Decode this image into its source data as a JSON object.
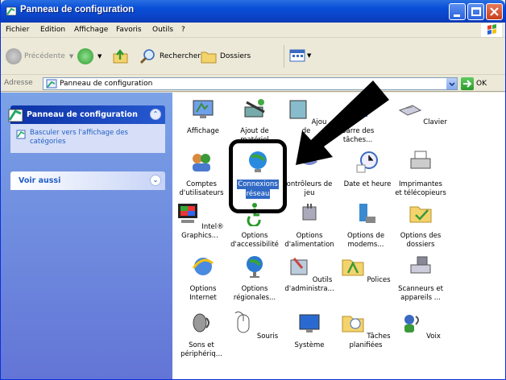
{
  "window": {
    "title": "Panneau de configuration"
  },
  "menu": [
    "Fichier",
    "Edition",
    "Affichage",
    "Favoris",
    "Outils",
    "?"
  ],
  "toolbar": {
    "back": "Précédente",
    "search": "Rechercher",
    "folders": "Dossiers"
  },
  "address": {
    "label": "Adresse",
    "value": "Panneau de configuration",
    "go": "OK"
  },
  "sidebar": {
    "panel1": {
      "title": "Panneau de configuration",
      "link": "Basculer vers l'affichage des catégories"
    },
    "panel2": {
      "title": "Voir aussi"
    }
  },
  "items": [
    {
      "l1": "Affichage",
      "l2": ""
    },
    {
      "l1": "Ajout de",
      "l2": "matériel"
    },
    {
      "l1": "Ajou",
      "l2": "de"
    },
    {
      "l1": "Barre des",
      "l2": "tâches..."
    },
    {
      "l1": "Clavier",
      "l2": ""
    },
    {
      "l1": "Comptes",
      "l2": "d'utilisateurs"
    },
    {
      "l1": "Connexions",
      "l2": "réseau"
    },
    {
      "l1": "ontrôleurs de",
      "l2": "jeu"
    },
    {
      "l1": "Date et heure",
      "l2": ""
    },
    {
      "l1": "Imprimantes",
      "l2": "et télécopieurs"
    },
    {
      "l1": "Intel®",
      "l2": "Graphics..."
    },
    {
      "l1": "Options",
      "l2": "d'accessibilité"
    },
    {
      "l1": "Options",
      "l2": "d'alimentation"
    },
    {
      "l1": "Options de",
      "l2": "modems..."
    },
    {
      "l1": "Options des",
      "l2": "dossiers"
    },
    {
      "l1": "Options",
      "l2": "Internet"
    },
    {
      "l1": "Options",
      "l2": "régionales..."
    },
    {
      "l1": "Outils",
      "l2": "d'administra..."
    },
    {
      "l1": "Polices",
      "l2": ""
    },
    {
      "l1": "Scanneurs et",
      "l2": "appareils ..."
    },
    {
      "l1": "Sons et",
      "l2": "périphériq..."
    },
    {
      "l1": "Souris",
      "l2": ""
    },
    {
      "l1": "Système",
      "l2": ""
    },
    {
      "l1": "Tâches",
      "l2": "planifiées"
    },
    {
      "l1": "Voix",
      "l2": ""
    }
  ],
  "colors": {
    "titlebar": "#0a4fd8",
    "sidebar": "#7ba2e7",
    "selection": "#316ac5",
    "annotation": "#000000"
  }
}
